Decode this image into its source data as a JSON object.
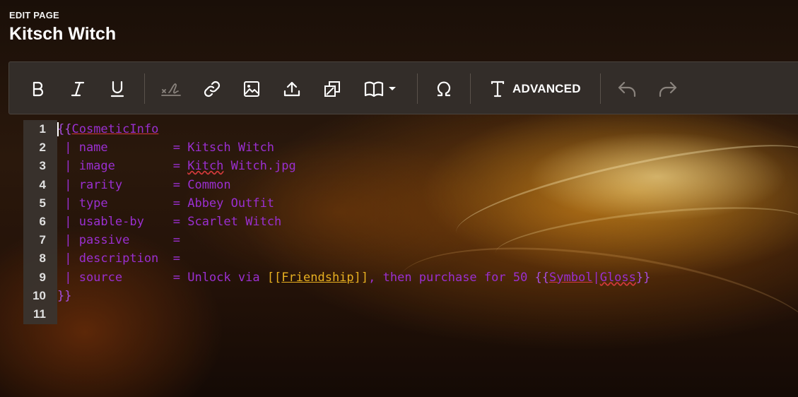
{
  "header": {
    "crumb": "EDIT PAGE",
    "title": "Kitsch Witch"
  },
  "toolbar": {
    "advanced_label": "ADVANCED",
    "icons": [
      "bold-icon",
      "italic-icon",
      "underline-icon",
      "signature-icon",
      "link-icon",
      "image-icon",
      "upload-icon",
      "gallery-icon",
      "book-icon",
      "omega-icon",
      "text-format-icon",
      "undo-icon",
      "redo-icon"
    ]
  },
  "editor": {
    "lines": [
      {
        "n": "1",
        "parts": [
          {
            "t": "{{",
            "c": "brace"
          },
          {
            "t": "CosmeticInfo",
            "c": "tmpl"
          }
        ]
      },
      {
        "n": "2",
        "parts": [
          {
            "t": " | name         = Kitsch Witch",
            "c": ""
          }
        ]
      },
      {
        "n": "3",
        "parts": [
          {
            "t": " | image        = ",
            "c": ""
          },
          {
            "t": "Kitch",
            "c": "spell"
          },
          {
            "t": " Witch.jpg",
            "c": ""
          }
        ]
      },
      {
        "n": "4",
        "parts": [
          {
            "t": " | rarity       = Common",
            "c": ""
          }
        ]
      },
      {
        "n": "5",
        "parts": [
          {
            "t": " | type         = Abbey Outfit",
            "c": ""
          }
        ]
      },
      {
        "n": "6",
        "parts": [
          {
            "t": " | usable-by    = Scarlet Witch",
            "c": ""
          }
        ]
      },
      {
        "n": "7",
        "parts": [
          {
            "t": " | passive      =",
            "c": ""
          }
        ]
      },
      {
        "n": "8",
        "parts": [
          {
            "t": " | description  =",
            "c": ""
          }
        ]
      },
      {
        "n": "9",
        "parts": [
          {
            "t": " | source       = Unlock via ",
            "c": ""
          },
          {
            "t": "[[",
            "c": "link-br"
          },
          {
            "t": "Friendship",
            "c": "link-txt"
          },
          {
            "t": "]]",
            "c": "link-br"
          },
          {
            "t": ", then purchase for 50 ",
            "c": ""
          },
          {
            "t": "{{",
            "c": "brace"
          },
          {
            "t": "Symbol",
            "c": "tmpl"
          },
          {
            "t": "|",
            "c": ""
          },
          {
            "t": "Gloss",
            "c": "spell"
          },
          {
            "t": "}}",
            "c": "brace"
          }
        ]
      },
      {
        "n": "10",
        "parts": [
          {
            "t": "}}",
            "c": "brace"
          }
        ]
      },
      {
        "n": "11",
        "parts": []
      }
    ]
  }
}
